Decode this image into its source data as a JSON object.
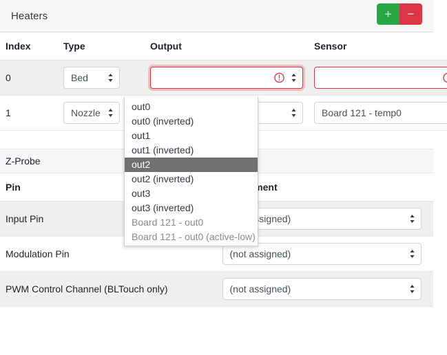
{
  "panel": {
    "title": "Heaters",
    "add_label": "+",
    "remove_label": "−"
  },
  "heaters_table": {
    "columns": [
      "Index",
      "Type",
      "Output",
      "Sensor"
    ],
    "rows": [
      {
        "index": "0",
        "type": "Bed",
        "output": "",
        "output_state": "invalid",
        "sensor": "",
        "sensor_state": "invalid"
      },
      {
        "index": "1",
        "type": "Nozzle",
        "output": "",
        "output_state": "normal",
        "sensor": "Board 121 - temp0",
        "sensor_state": "normal"
      }
    ]
  },
  "output_dropdown": {
    "options": [
      {
        "label": "out0",
        "state": "normal"
      },
      {
        "label": "out0 (inverted)",
        "state": "normal"
      },
      {
        "label": "out1",
        "state": "normal"
      },
      {
        "label": "out1 (inverted)",
        "state": "normal"
      },
      {
        "label": "out2",
        "state": "highlighted"
      },
      {
        "label": "out2 (inverted)",
        "state": "normal"
      },
      {
        "label": "out3",
        "state": "normal"
      },
      {
        "label": "out3 (inverted)",
        "state": "normal"
      },
      {
        "label": "Board 121 - out0",
        "state": "muted"
      },
      {
        "label": "Board 121 - out0 (active-low)",
        "state": "muted"
      }
    ]
  },
  "zprobe": {
    "section_title": "Z-Probe",
    "columns": [
      "Pin",
      "Assignment"
    ],
    "rows": [
      {
        "label": "Input Pin",
        "value": "(not assigned)"
      },
      {
        "label": "Modulation Pin",
        "value": "(not assigned)"
      },
      {
        "label": "PWM Control Channel (BLTouch only)",
        "value": "(not assigned)"
      }
    ]
  },
  "colors": {
    "add": "#28a745",
    "remove": "#dc3545",
    "invalid": "#dc3545",
    "highlight": "#707070"
  }
}
